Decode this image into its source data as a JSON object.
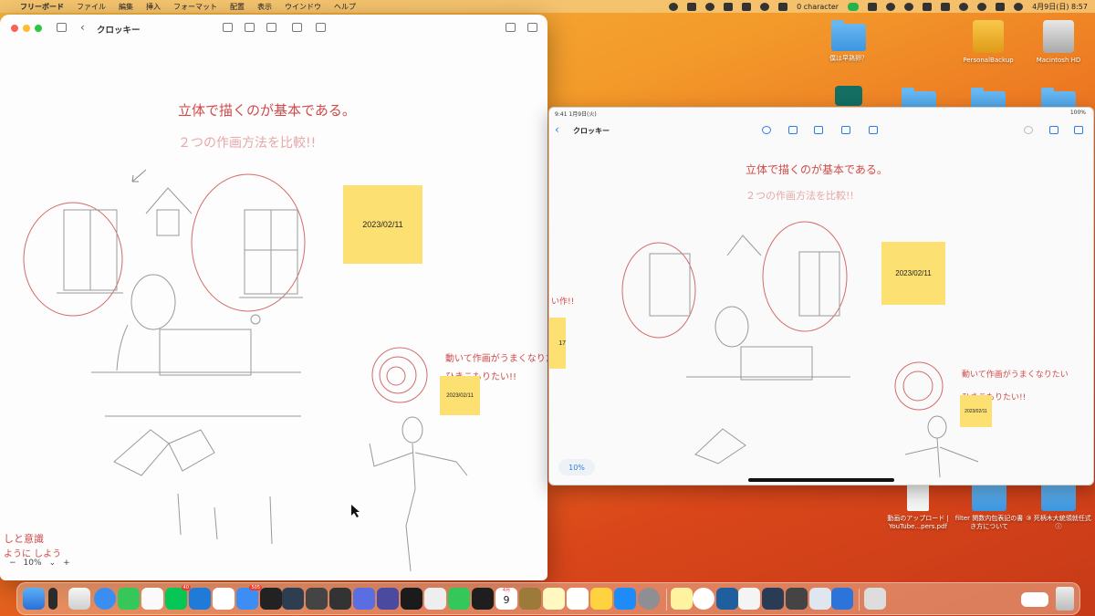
{
  "menubar": {
    "app": "フリーボード",
    "items": [
      "ファイル",
      "編集",
      "挿入",
      "フォーマット",
      "配置",
      "表示",
      "ウインドウ",
      "ヘルプ"
    ],
    "character": "0 character",
    "datetime": "4月9日(日) 8:57"
  },
  "main_window": {
    "title": "クロッキー",
    "handwriting_top": "立体で描くのが基本である。",
    "handwriting_sub": "２つの作画方法を比較!!",
    "sticky_large": "2023/02/11",
    "sticky_small": "2023/02/11",
    "handwriting_right1": "動いて作画がうまくなりたい",
    "handwriting_right2": "ひきこもりたい!!",
    "handwriting_left1": "しと意識",
    "handwriting_left2": "ように しよう",
    "zoom": "10%",
    "zoom_minus": "−",
    "zoom_plus": "+"
  },
  "ipad_window": {
    "time": "9:41",
    "date": "1月9日(火)",
    "battery": "100%",
    "title": "クロッキー",
    "handwriting_top": "立体で描くのが基本である。",
    "handwriting_sub": "２つの作画方法を比較!!",
    "sticky_large": "2023/02/11",
    "sticky_small": "2023/02/11",
    "handwriting_right1": "動いて作画がうまくなりたい",
    "handwriting_right2": "ひきこもりたい!!",
    "edge_text1": "い作!!",
    "edge_text2": "17",
    "zoom": "10%"
  },
  "desktop": {
    "icons": [
      {
        "label": "僕は早熟卵？"
      },
      {
        "label": "PersonalBackup"
      },
      {
        "label": "Macintosh HD"
      },
      {
        "label": "動画のアップロード | YouTube...pers.pdf"
      },
      {
        "label": "filter 関数内包表記の書き方について"
      },
      {
        "label": "③ 死柄木大統領就任式 ⓘ"
      }
    ]
  },
  "dock": {
    "calendar_day": "9",
    "calendar_month": "4月",
    "badge_line": "40",
    "badge_mail": "505"
  },
  "colors": {
    "sticky": "#fde072",
    "accent": "#2b7de9",
    "sketch": "#8a8a8a",
    "red_pen": "#d04a4a"
  }
}
